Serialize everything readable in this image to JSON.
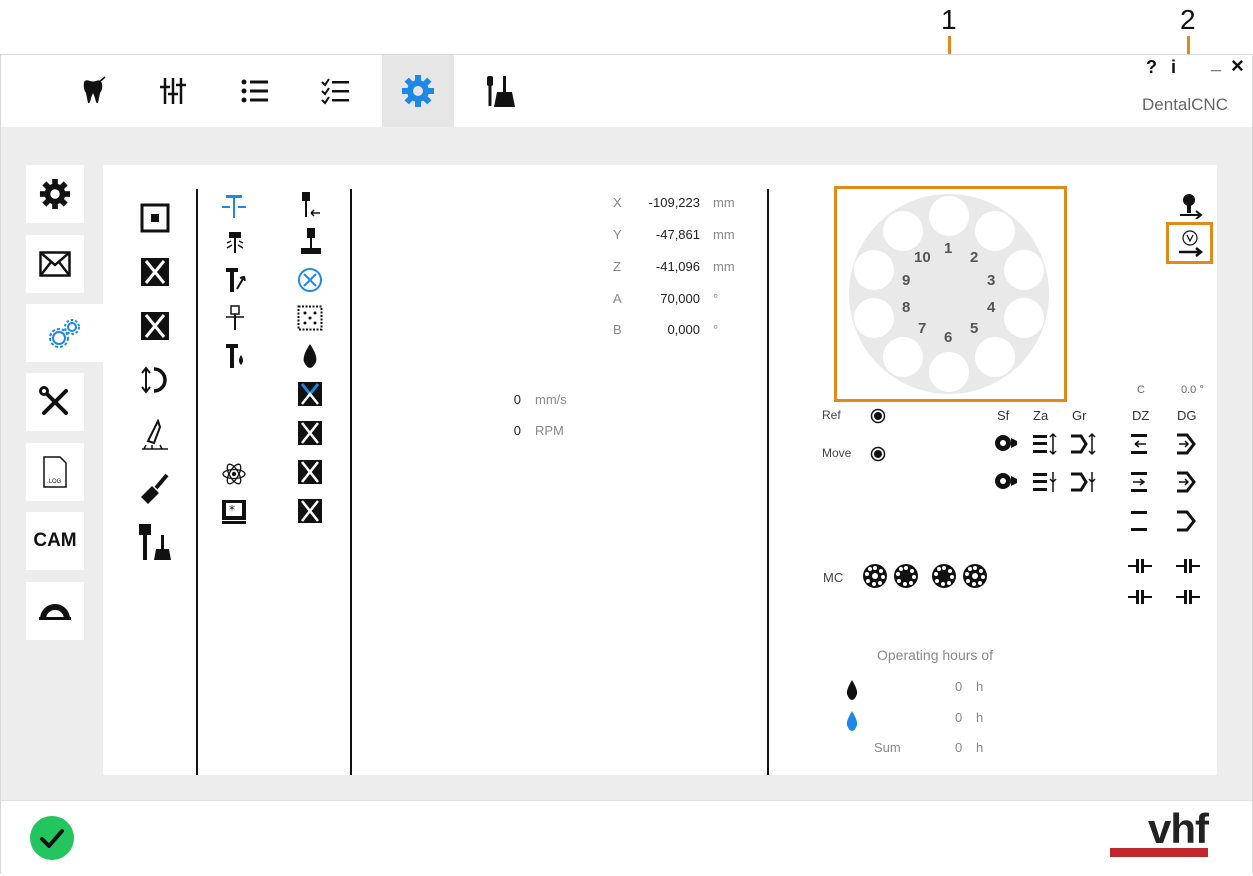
{
  "callouts": {
    "one": "1",
    "two": "2"
  },
  "window": {
    "help": "?",
    "info": "i",
    "minimize": "_",
    "close": "×",
    "brand": "DentalCNC"
  },
  "topbar": {
    "tabs": [
      {
        "icon": "tooth-icon"
      },
      {
        "icon": "sliders-icon"
      },
      {
        "icon": "list-icon"
      },
      {
        "icon": "checklist-icon"
      },
      {
        "icon": "gear-icon",
        "active": true
      },
      {
        "icon": "tools-brush-icon"
      }
    ]
  },
  "sidebar": {
    "cam_label": "CAM"
  },
  "coordinates": {
    "axes": [
      {
        "label": "X",
        "value": "-109,223",
        "unit": "mm"
      },
      {
        "label": "Y",
        "value": "-47,861",
        "unit": "mm"
      },
      {
        "label": "Z",
        "value": "-41,096",
        "unit": "mm"
      },
      {
        "label": "A",
        "value": "70,000",
        "unit": "°"
      },
      {
        "label": "B",
        "value": "0,000",
        "unit": "°"
      }
    ],
    "feed": {
      "value": "0",
      "unit": "mm/s"
    },
    "spindle": {
      "value": "0",
      "unit": "RPM"
    }
  },
  "changer": {
    "slots": [
      "1",
      "2",
      "3",
      "4",
      "5",
      "6",
      "7",
      "8",
      "9",
      "10"
    ]
  },
  "status": {
    "ref_label": "Ref",
    "move_label": "Move",
    "c_label": "C",
    "c_value": "0.0 °",
    "col_sf": "Sf",
    "col_za": "Za",
    "col_gr": "Gr",
    "col_dz": "DZ",
    "col_dg": "DG",
    "mc_label": "MC"
  },
  "hours": {
    "title": "Operating hours of",
    "rows": [
      {
        "icon": "black-drop-icon",
        "label": "",
        "value": "0",
        "unit": "h"
      },
      {
        "icon": "blue-drop-icon",
        "label": "",
        "value": "0",
        "unit": "h"
      },
      {
        "icon": "",
        "label": "Sum",
        "value": "0",
        "unit": "h"
      }
    ]
  },
  "logo": {
    "text": "vhf"
  },
  "colors": {
    "accent": "#1e88e5",
    "highlight": "#e08a1e",
    "ok": "#22c55e",
    "brand_red": "#c0272d"
  }
}
